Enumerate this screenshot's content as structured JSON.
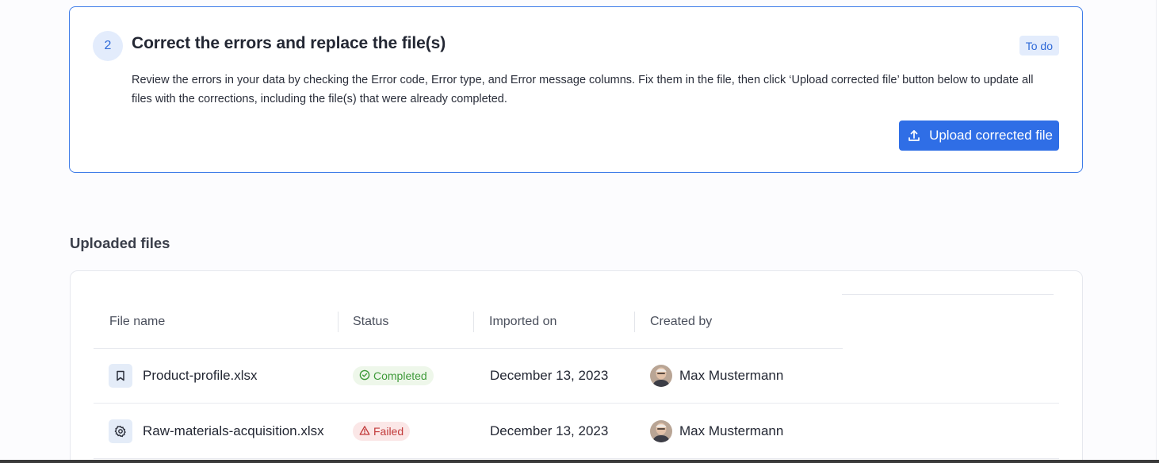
{
  "step": {
    "number": "2",
    "title": "Correct the errors and replace the file(s)",
    "badge": "To do",
    "description": "Review the errors in your data by checking the Error code, Error type, and Error message columns. Fix them in the file, then click ‘Upload corrected file’ button below to update all files with the corrections, including the file(s) that were already completed.",
    "button_label": "Upload corrected file",
    "button_icon": "upload-icon"
  },
  "uploaded_files": {
    "title": "Uploaded files",
    "columns": [
      "File name",
      "Status",
      "Imported on",
      "Created by"
    ],
    "rows": [
      {
        "file_name": "Product-profile.xlsx",
        "file_icon": "bookmark-icon",
        "status": "Completed",
        "status_icon": "check-circle-icon",
        "imported_on": "December 13, 2023",
        "created_by": "Max Mustermann"
      },
      {
        "file_name": "Raw-materials-acquisition.xlsx",
        "file_icon": "gear-icon",
        "status": "Failed",
        "status_icon": "warning-triangle-icon",
        "imported_on": "December 13, 2023",
        "created_by": "Max Mustermann"
      }
    ]
  },
  "colors": {
    "accent": "#2f6ee6",
    "badge_bg": "#e3ecfc",
    "success": "#3f9a3a",
    "error": "#c23b3b"
  }
}
